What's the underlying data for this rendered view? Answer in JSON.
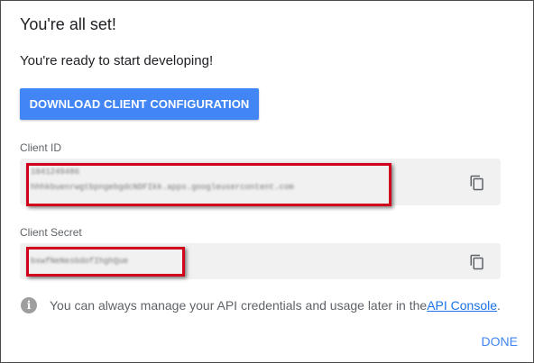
{
  "dialog": {
    "title": "You're all set!",
    "subtitle": "You're ready to start developing!",
    "download_button": "DOWNLOAD CLIENT CONFIGURATION",
    "client_id": {
      "label": "Client ID",
      "line1": "1041249486",
      "line2": "hhhkbuenrwgtbpngebgdcNDFIkk.apps.googleusercontent.com"
    },
    "client_secret": {
      "label": "Client Secret",
      "value": "bxwfNeNesbdofIhghQue"
    },
    "info_text": "You can always manage your API credentials and usage later in the ",
    "info_link": "API Console",
    "info_end": ".",
    "done_button": "DONE"
  },
  "colors": {
    "accent": "#4285f4",
    "highlight_box": "#d0021b"
  }
}
